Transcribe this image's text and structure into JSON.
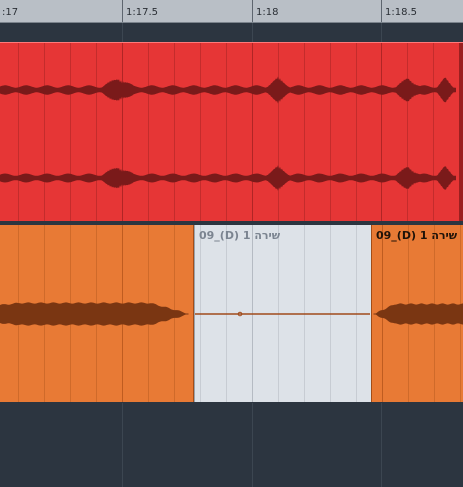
{
  "ruler": {
    "labels": [
      ":17",
      "1:17.5",
      "1:18",
      "1:18.5"
    ]
  },
  "tracks": {
    "vocal_red": {
      "color": "#e63636",
      "wave_color": "#7a1a1a"
    },
    "vocal_orange": {
      "color": "#e87a35",
      "wave_color": "#7a3612",
      "events": [
        {
          "title": ""
        },
        {
          "title": "09_(D) שירה 1",
          "selected": true
        },
        {
          "title": "09_(D) שירה 1"
        }
      ]
    }
  },
  "colors": {
    "background": "#2c3540",
    "ruler": "#b9bfc6",
    "selected_event": "#dde2e8"
  }
}
